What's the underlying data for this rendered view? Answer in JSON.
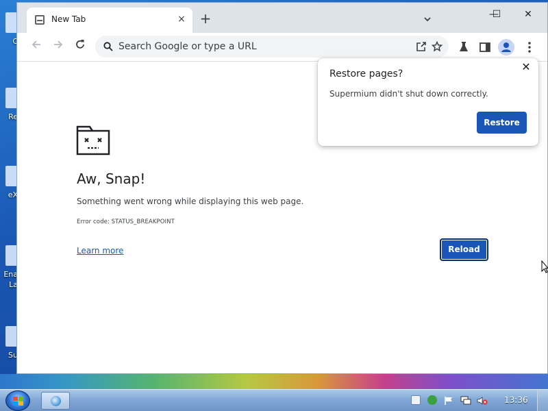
{
  "desktop": {
    "icon_labels": [
      "C",
      "Re",
      "eX",
      "Ena",
      "La",
      "Su"
    ]
  },
  "browser": {
    "tab": {
      "title": "New Tab",
      "close": "×"
    },
    "new_tab": "+",
    "window_controls": {
      "minimize": "—",
      "maximize": "☐",
      "close": "✕"
    },
    "omnibox": {
      "placeholder": "Search Google or type a URL",
      "value": ""
    }
  },
  "error_page": {
    "title": "Aw, Snap!",
    "description": "Something went wrong while displaying this web page.",
    "error_code": "Error code: STATUS_BREAKPOINT",
    "learn_more": "Learn more",
    "reload": "Reload"
  },
  "restore_bubble": {
    "title": "Restore pages?",
    "message": "Supermium didn't shut down correctly.",
    "restore": "Restore",
    "close": "✕"
  },
  "taskbar": {
    "clock": "13:36"
  },
  "colors": {
    "accent_blue": "#1a56b8",
    "titlebar": "#dee3ea",
    "omnibox": "#f1f3f4"
  },
  "icons": {
    "toolbar": [
      "back-icon",
      "forward-icon",
      "reload-icon",
      "search-icon",
      "share-icon",
      "bookmark-star-icon",
      "labs-flask-icon",
      "side-panel-icon",
      "profile-icon",
      "menu-icon"
    ],
    "tray": [
      "notes-icon",
      "security-icon",
      "flag-icon",
      "network-icon",
      "volume-muted-icon"
    ]
  }
}
